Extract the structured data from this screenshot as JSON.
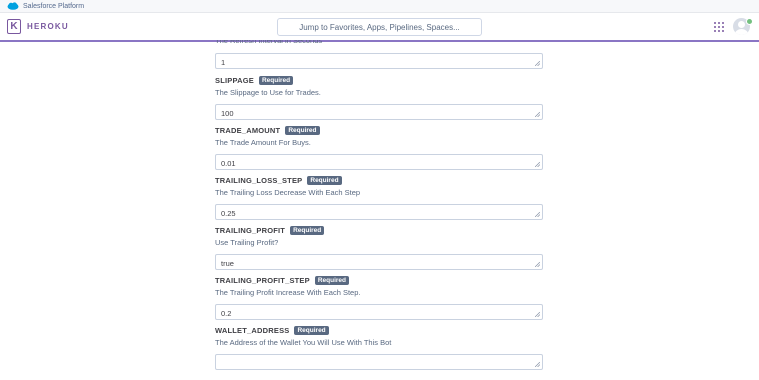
{
  "platform_bar": {
    "label": "Salesforce Platform"
  },
  "header": {
    "logo_letter": "K",
    "brand": "HEROKU",
    "search_placeholder": "Jump to Favorites, Apps, Pipelines, Spaces...",
    "apps_icon": "grid-dots-icon",
    "avatar_icon": "user-avatar-icon"
  },
  "colors": {
    "brand": "#79589f",
    "accent_line": "#8a75c4",
    "badge": "#596981"
  },
  "partial_label": "The Refresh Interval in Seconds",
  "fields": [
    {
      "value": "1"
    },
    {
      "name": "SLIPPAGE",
      "badge": "Required",
      "description": "The Slippage to Use for Trades.",
      "value": "100"
    },
    {
      "name": "TRADE_AMOUNT",
      "badge": "Required",
      "description": "The Trade Amount For Buys.",
      "value": "0.01"
    },
    {
      "name": "TRAILING_LOSS_STEP",
      "badge": "Required",
      "description": "The Trailing Loss Decrease With Each Step",
      "value": "0.25"
    },
    {
      "name": "TRAILING_PROFIT",
      "badge": "Required",
      "description": "Use Trailing Profit?",
      "value": "true"
    },
    {
      "name": "TRAILING_PROFIT_STEP",
      "badge": "Required",
      "description": "The Trailing Profit Increase With Each Step.",
      "value": "0.2"
    },
    {
      "name": "WALLET_ADDRESS",
      "badge": "Required",
      "description": "The Address of the Wallet You Will Use With This Bot",
      "value": ""
    }
  ]
}
